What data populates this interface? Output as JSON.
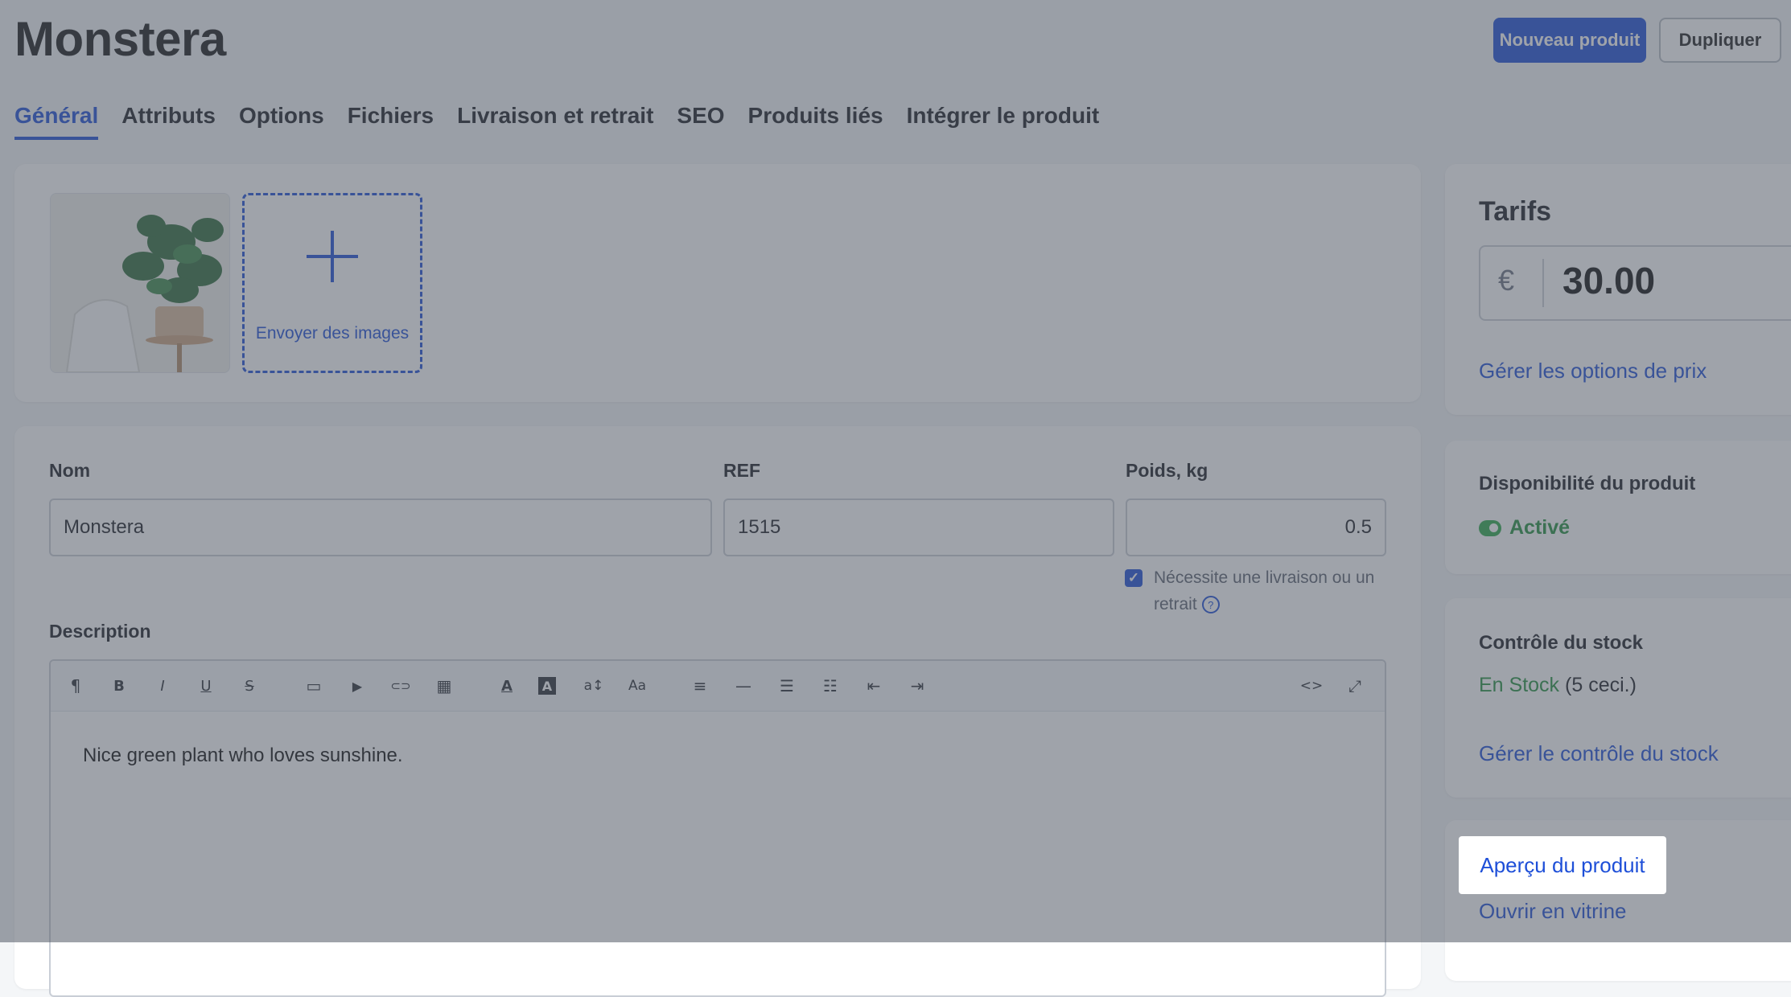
{
  "header": {
    "title": "Monstera",
    "new_product_label": "Nouveau produit",
    "duplicate_label": "Dupliquer"
  },
  "tabs": [
    {
      "label": "Général",
      "active": true
    },
    {
      "label": "Attributs",
      "active": false
    },
    {
      "label": "Options",
      "active": false
    },
    {
      "label": "Fichiers",
      "active": false
    },
    {
      "label": "Livraison et retrait",
      "active": false
    },
    {
      "label": "SEO",
      "active": false
    },
    {
      "label": "Produits liés",
      "active": false
    },
    {
      "label": "Intégrer le produit",
      "active": false
    }
  ],
  "images": {
    "upload_label": "Envoyer des images"
  },
  "form": {
    "name_label": "Nom",
    "name_value": "Monstera",
    "ref_label": "REF",
    "ref_value": "1515",
    "weight_label": "Poids, kg",
    "weight_value": "0.5",
    "shipping_checkbox_label_1": "Nécessite une livraison ou un",
    "shipping_checkbox_label_2": "retrait",
    "shipping_checked": true,
    "description_label": "Description",
    "description_text": "Nice green plant who loves sunshine."
  },
  "editor_toolbar": [
    {
      "icon": "paragraph-icon",
      "glyph": "¶"
    },
    {
      "icon": "bold-icon",
      "glyph": "B"
    },
    {
      "icon": "italic-icon",
      "glyph": "I"
    },
    {
      "icon": "underline-icon",
      "glyph": "U"
    },
    {
      "icon": "strikethrough-icon",
      "glyph": "S"
    },
    {
      "icon": "image-icon",
      "glyph": "▭"
    },
    {
      "icon": "video-icon",
      "glyph": "▶"
    },
    {
      "icon": "link-icon",
      "glyph": "⊂⊃"
    },
    {
      "icon": "table-icon",
      "glyph": "▦"
    },
    {
      "icon": "text-color-icon",
      "glyph": "A"
    },
    {
      "icon": "background-color-icon",
      "glyph": "A"
    },
    {
      "icon": "font-size-icon",
      "glyph": "a↕"
    },
    {
      "icon": "font-family-icon",
      "glyph": "Aa"
    },
    {
      "icon": "align-icon",
      "glyph": "≡"
    },
    {
      "icon": "horizontal-line-icon",
      "glyph": "—"
    },
    {
      "icon": "bulleted-list-icon",
      "glyph": "☰"
    },
    {
      "icon": "numbered-list-icon",
      "glyph": "☷"
    },
    {
      "icon": "outdent-icon",
      "glyph": "⇤"
    },
    {
      "icon": "indent-icon",
      "glyph": "⇥"
    },
    {
      "icon": "code-view-icon",
      "glyph": "<>"
    },
    {
      "icon": "fullscreen-icon",
      "glyph": "⤢"
    }
  ],
  "pricing": {
    "title": "Tarifs",
    "currency": "€",
    "price": "30.00",
    "manage_link": "Gérer les options de prix"
  },
  "availability": {
    "title": "Disponibilité du produit",
    "status": "Activé"
  },
  "stock": {
    "title": "Contrôle du stock",
    "status": "En Stock",
    "count": "(5 ceci.)",
    "manage_link": "Gérer le contrôle du stock"
  },
  "links": {
    "preview": "Aperçu du produit",
    "storefront": "Ouvrir en vitrine"
  },
  "colors": {
    "accent": "#1e4fd8",
    "success": "#25913f"
  }
}
